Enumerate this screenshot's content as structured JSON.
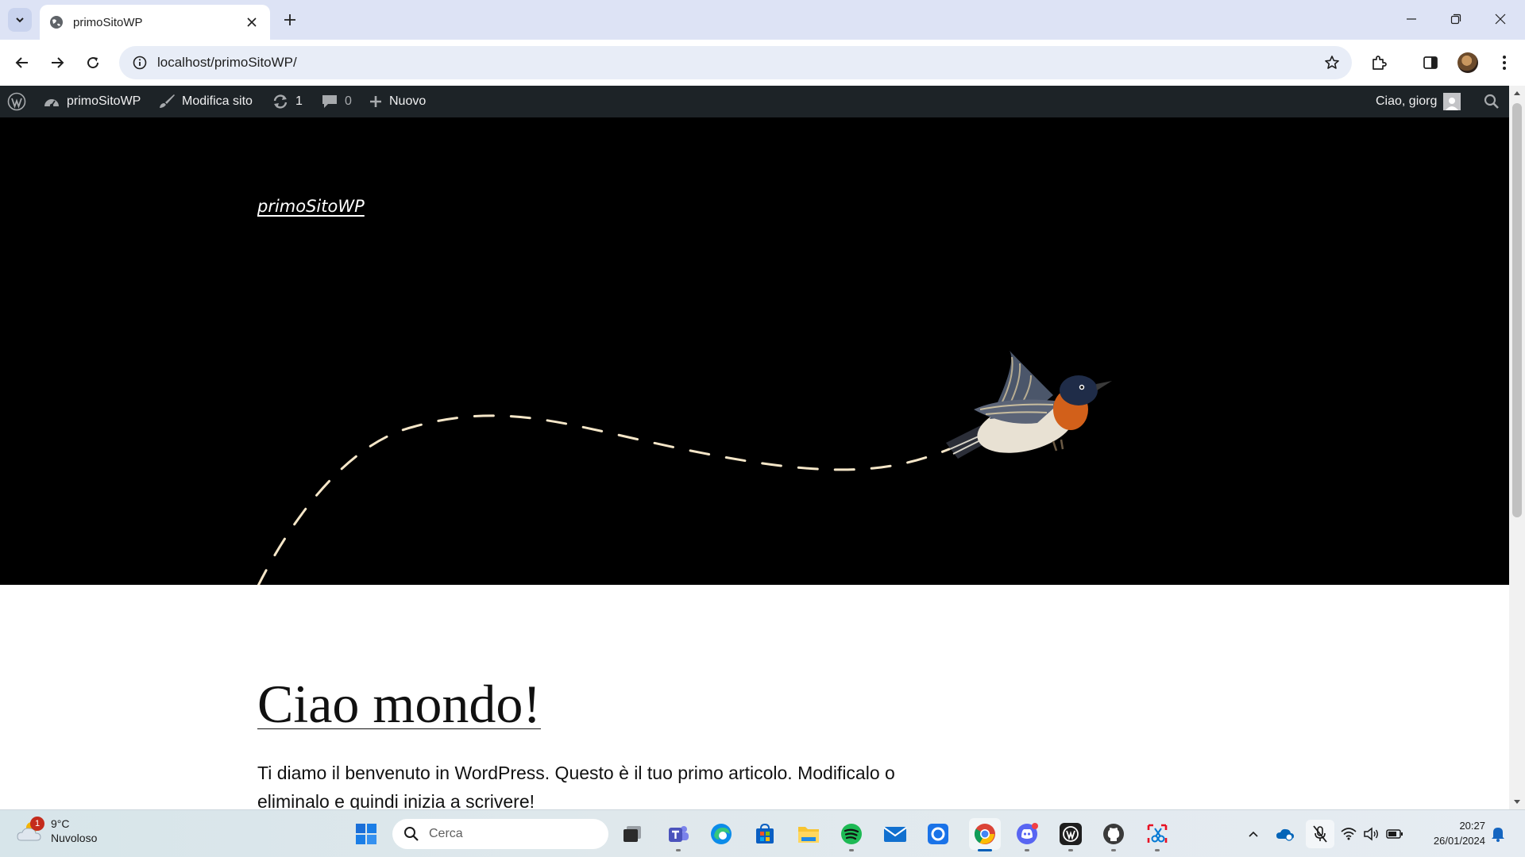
{
  "browser": {
    "tab_title": "primoSitoWP",
    "url": "localhost/primoSitoWP/"
  },
  "adminbar": {
    "site_name": "primoSitoWP",
    "edit_site": "Modifica sito",
    "updates_count": "1",
    "comments_count": "0",
    "new_label": "Nuovo",
    "greeting": "Ciao, giorg"
  },
  "page": {
    "site_title": "primoSitoWP",
    "post_title": "Ciao mondo!",
    "post_excerpt": "Ti diamo il benvenuto in WordPress. Questo è il tuo primo articolo. Modificalo o eliminalo e quindi inizia a scrivere!"
  },
  "taskbar": {
    "weather_temp": "9°C",
    "weather_desc": "Nuvoloso",
    "weather_badge": "1",
    "search_label": "Cerca",
    "time": "20:27",
    "date": "26/01/2024"
  },
  "colors": {
    "adminbar_bg": "#1d2327",
    "hero_bg": "#000000",
    "path_stroke": "#f5e6c8"
  }
}
